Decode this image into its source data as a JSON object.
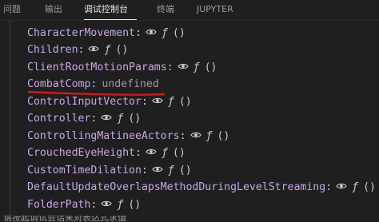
{
  "tabs": [
    {
      "label": "问题"
    },
    {
      "label": "输出"
    },
    {
      "label": "调试控制台",
      "active": true
    },
    {
      "label": "终端"
    },
    {
      "label": "JUPYTER"
    }
  ],
  "function_glyph": "ƒ",
  "parens_glyph": "()",
  "separator": ":",
  "properties": [
    {
      "name": "CharacterMovement",
      "kind": "getter"
    },
    {
      "name": "Children",
      "kind": "getter"
    },
    {
      "name": "ClientRootMotionParams",
      "kind": "getter"
    },
    {
      "name": "CombatComp",
      "kind": "value",
      "value": "undefined",
      "annotated": true
    },
    {
      "name": "ControlInputVector",
      "kind": "getter"
    },
    {
      "name": "Controller",
      "kind": "getter"
    },
    {
      "name": "ControllingMatineeActors",
      "kind": "getter"
    },
    {
      "name": "CrouchedEyeHeight",
      "kind": "getter"
    },
    {
      "name": "CustomTimeDilation",
      "kind": "getter"
    },
    {
      "name": "DefaultUpdateOverlapsMethodDuringLevelStreaming",
      "kind": "getter"
    },
    {
      "name": "FolderPath",
      "kind": "getter"
    }
  ],
  "bottom_input": {
    "text": "请按起调试会话来对表达式求值"
  },
  "colors": {
    "background": "#1f1f1f",
    "property": "#c9a6e8",
    "text": "#cccccc",
    "muted": "#9d9d9d",
    "annotation": "#e0171d"
  }
}
